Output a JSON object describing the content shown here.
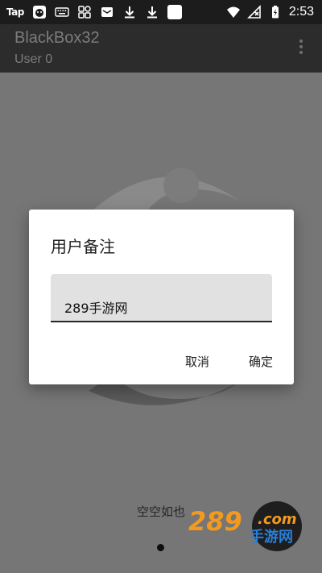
{
  "status_bar": {
    "app_badge": "Tap",
    "time": "2:53",
    "icons": [
      "tap-app-icon",
      "cat-app-icon",
      "keyboard-icon",
      "grid-app-icon",
      "message-icon",
      "download-icon",
      "download-icon",
      "white-square-app-icon",
      "wifi-icon",
      "no-signal-icon",
      "battery-charging-icon"
    ]
  },
  "app_bar": {
    "title": "BlackBox32",
    "subtitle": "User 0",
    "menu_icon": "overflow-menu-icon"
  },
  "dialog": {
    "title": "用户备注",
    "input_value": "289手游网",
    "cancel_label": "取消",
    "ok_label": "确定"
  },
  "content": {
    "empty_text": "空空如也"
  },
  "watermark": {
    "brand_number": "289",
    "brand_suffix": ".com",
    "brand_name": "手游网"
  },
  "colors": {
    "status_bar": "#1c1c1c",
    "app_bar": "#2c2c2c",
    "background": "#767676",
    "dialog": "#ffffff",
    "input_bg": "#e1e1e1",
    "watermark_orange": "#f39a1e",
    "watermark_blue": "#2a7fd6"
  }
}
